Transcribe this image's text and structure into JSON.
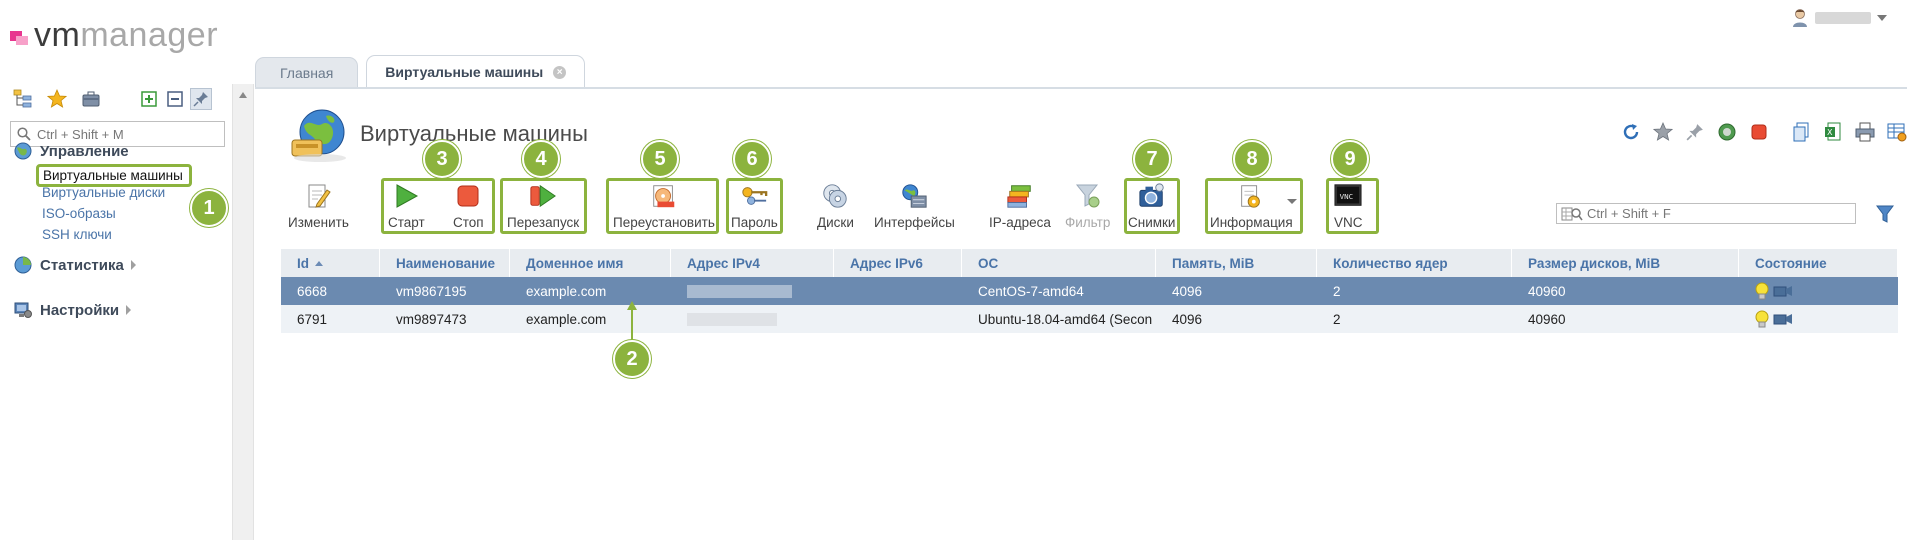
{
  "logo": {
    "vm": "vm",
    "manager": "manager"
  },
  "search": {
    "placeholder": "Ctrl + Shift + M"
  },
  "sidebar": {
    "sections": [
      {
        "label": "Управление",
        "items": [
          "Виртуальные машины",
          "Виртуальные диски",
          "ISO-образы",
          "SSH ключи"
        ]
      },
      {
        "label": "Статистика"
      },
      {
        "label": "Настройки"
      }
    ]
  },
  "tabs": [
    {
      "label": "Главная"
    },
    {
      "label": "Виртуальные машины",
      "close": "×"
    }
  ],
  "page": {
    "title": "Виртуальные машины"
  },
  "toolbar": {
    "edit": "Изменить",
    "start": "Старт",
    "stop": "Стоп",
    "restart": "Перезапуск",
    "reinstall": "Переустановить",
    "password": "Пароль",
    "disks": "Диски",
    "interfaces": "Интерфейсы",
    "ip": "IP-адреса",
    "filter": "Фильтр",
    "snapshots": "Снимки",
    "info": "Информация",
    "vnc": "VNC"
  },
  "grid_search": {
    "placeholder": "Ctrl + Shift + F"
  },
  "table": {
    "columns": [
      "Id",
      "Наименование",
      "Доменное имя",
      "Адрес IPv4",
      "Адрес IPv6",
      "ОС",
      "Память, MiB",
      "Количество ядер",
      "Размер дисков, MiB",
      "Состояние"
    ],
    "rows": [
      {
        "id": "6668",
        "name": "vm9867195",
        "domain": "example.com",
        "ipv6": "",
        "os": "CentOS-7-amd64",
        "memory": "4096",
        "cores": "2",
        "disk": "40960"
      },
      {
        "id": "6791",
        "name": "vm9897473",
        "domain": "example.com",
        "ipv6": "",
        "os": "Ubuntu-18.04-amd64 (Secon",
        "memory": "4096",
        "cores": "2",
        "disk": "40960"
      }
    ]
  },
  "badges": [
    "1",
    "2",
    "3",
    "4",
    "5",
    "6",
    "7",
    "8",
    "9"
  ],
  "colors": {
    "highlight": "#8cb33e",
    "selected_row": "#6b8ab0",
    "link": "#4a74a8"
  }
}
